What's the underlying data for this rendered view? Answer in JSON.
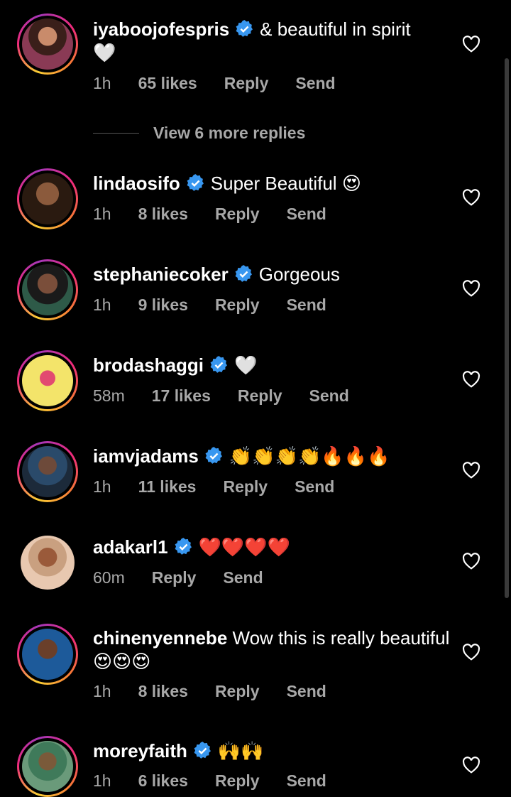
{
  "comments": [
    {
      "username": "iyaboojofespris",
      "verified": true,
      "text": "& beautiful in spirit",
      "emoji": "🤍",
      "time": "1h",
      "likes": "65 likes",
      "reply": "Reply",
      "send": "Send"
    },
    {
      "username": "lindaosifo",
      "verified": true,
      "text": "Super Beautiful",
      "emoji": "😍",
      "time": "1h",
      "likes": "8 likes",
      "reply": "Reply",
      "send": "Send"
    },
    {
      "username": "stephaniecoker",
      "verified": true,
      "text": "Gorgeous",
      "emoji": "",
      "time": "1h",
      "likes": "9 likes",
      "reply": "Reply",
      "send": "Send"
    },
    {
      "username": "brodashaggi",
      "verified": true,
      "text": "",
      "emoji": "🤍",
      "time": "58m",
      "likes": "17 likes",
      "reply": "Reply",
      "send": "Send"
    },
    {
      "username": "iamvjadams",
      "verified": true,
      "text": "",
      "emoji": "👏👏👏👏🔥🔥🔥",
      "time": "1h",
      "likes": "11 likes",
      "reply": "Reply",
      "send": "Send"
    },
    {
      "username": "adakarl1",
      "verified": true,
      "text": "",
      "emoji": "❤️❤️❤️❤️",
      "time": "60m",
      "likes": "",
      "reply": "Reply",
      "send": "Send"
    },
    {
      "username": "chinenyennebe",
      "verified": false,
      "text": "Wow this is really beautiful",
      "emoji": "😍😍😍",
      "time": "1h",
      "likes": "8 likes",
      "reply": "Reply",
      "send": "Send"
    },
    {
      "username": "moreyfaith",
      "verified": true,
      "text": "",
      "emoji": "🙌🙌",
      "time": "1h",
      "likes": "6 likes",
      "reply": "Reply",
      "send": "Send"
    }
  ],
  "view_replies": {
    "label": "View 6 more replies"
  },
  "icons": {
    "verified": "verified-badge-icon",
    "like": "heart-outline-icon"
  },
  "colors": {
    "background": "#000000",
    "verified": "#3897f0",
    "muted": "#a8a8a8"
  }
}
